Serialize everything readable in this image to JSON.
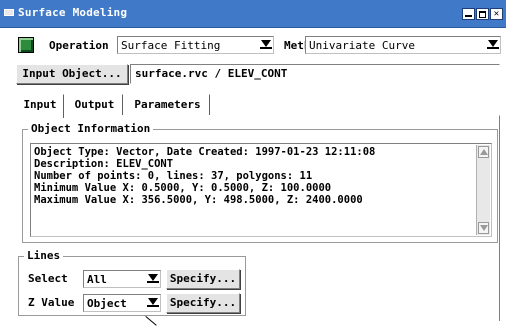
{
  "window": {
    "title": "Surface Modeling",
    "title_bar_color": "#3f79c8"
  },
  "toolbar": {
    "operation_label": "Operation",
    "operation_value": "Surface Fitting",
    "method_label": "Method",
    "method_value": "Univariate Curve"
  },
  "input_object": {
    "button_label": "Input Object...",
    "value": "surface.rvc / ELEV_CONT"
  },
  "tabs": [
    {
      "label": "Input",
      "active": true
    },
    {
      "label": "Output",
      "active": false
    },
    {
      "label": "Parameters",
      "active": false
    }
  ],
  "object_information": {
    "group_label": "Object Information",
    "lines": [
      "Object Type: Vector, Date Created: 1997-01-23 12:11:08",
      "Description: ELEV_CONT",
      "Number of points: 0, lines: 37, polygons: 11",
      "Minimum Value X: 0.5000, Y: 0.5000, Z: 100.0000",
      "Maximum Value X: 356.5000, Y: 498.5000, Z: 2400.0000"
    ]
  },
  "lines_group": {
    "group_label": "Lines",
    "select_label": "Select",
    "select_value": "All",
    "select_specify": "Specify...",
    "zvalue_label": "Z Value",
    "zvalue_value": "Object",
    "zvalue_specify": "Specify..."
  },
  "icons": {
    "operation_icon": "surface-fitting-icon",
    "system_menu": "system-menu-icon",
    "minimize": "minimize-icon",
    "maximize": "maximize-icon",
    "close": "close-icon"
  }
}
